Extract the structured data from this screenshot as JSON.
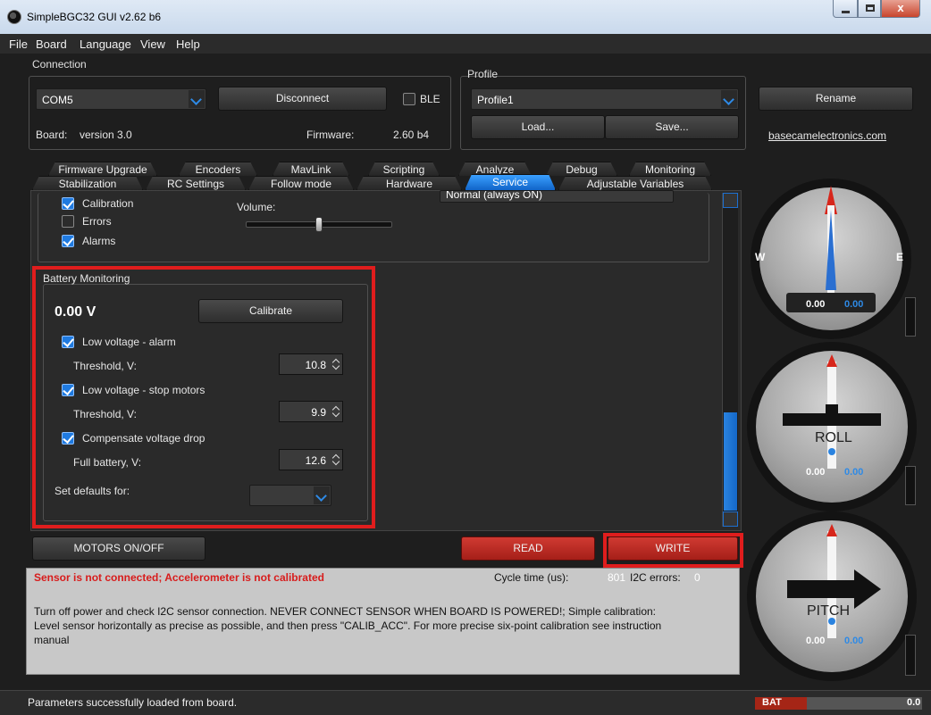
{
  "window": {
    "title": "SimpleBGC32 GUI v2.62 b6",
    "close_glyph": "x"
  },
  "menu": [
    "File",
    "Board",
    "Language",
    "View",
    "Help"
  ],
  "connection": {
    "label": "Connection",
    "port": "COM5",
    "disconnect_label": "Disconnect",
    "ble_label": "BLE",
    "board_label": "Board:",
    "board_value": "version 3.0",
    "firmware_label": "Firmware:",
    "firmware_value": "2.60 b4"
  },
  "profile": {
    "label": "Profile",
    "selected": "Profile1",
    "rename_label": "Rename",
    "load_label": "Load...",
    "save_label": "Save...",
    "website": "basecamelectronics.com"
  },
  "tabs_back": [
    "Firmware Upgrade",
    "Encoders",
    "MavLink",
    "Scripting",
    "Analyze",
    "Debug",
    "Monitoring"
  ],
  "tabs_front": [
    "Stabilization",
    "RC Settings",
    "Follow mode",
    "Hardware",
    "Service",
    "Adjustable Variables"
  ],
  "active_tab": "Service",
  "service": {
    "cut_dropdown": "Normal (always ON)",
    "volume_label": "Volume:",
    "checks_top": [
      {
        "label": "Calibration",
        "checked": true
      },
      {
        "label": "Errors",
        "checked": false
      },
      {
        "label": "Alarms",
        "checked": true
      }
    ],
    "battery": {
      "title": "Battery Monitoring",
      "voltage": "0.00 V",
      "calibrate_label": "Calibrate",
      "low_alarm": {
        "label": "Low voltage - alarm",
        "checked": true,
        "threshold_label": "Threshold, V:",
        "value": "10.8"
      },
      "low_stop": {
        "label": "Low voltage - stop motors",
        "checked": true,
        "threshold_label": "Threshold, V:",
        "value": "9.9"
      },
      "compensate": {
        "label": "Compensate voltage drop",
        "checked": true,
        "full_label": "Full battery, V:",
        "value": "12.6"
      },
      "defaults_label": "Set defaults for:"
    }
  },
  "actions": {
    "motors_label": "MOTORS ON/OFF",
    "read_label": "READ",
    "write_label": "WRITE"
  },
  "status_panel": {
    "error": "Sensor is not connected; Accelerometer is not calibrated",
    "cycle_label": "Cycle time (us):",
    "cycle_value": "801",
    "i2c_label": "I2C errors:",
    "i2c_value": "0",
    "message": "Turn off power and check I2C sensor connection. NEVER CONNECT SENSOR WHEN BOARD IS POWERED!; Simple calibration: Level sensor horizontally as precise as possible, and then press \"CALIB_ACC\". For more precise six-point calibration see instruction manual"
  },
  "statusbar": {
    "message": "Parameters successfully loaded from board.",
    "bat_label": "BAT",
    "bat_value": "0.0"
  },
  "gauges": {
    "yaw": {
      "west": "W",
      "east": "E",
      "value_white": "0.00",
      "value_blue": "0.00"
    },
    "roll": {
      "label": "ROLL",
      "value_white": "0.00",
      "value_blue": "0.00"
    },
    "pitch": {
      "label": "PITCH",
      "value_white": "0.00",
      "value_blue": "0.00"
    }
  },
  "colors": {
    "accent": "#1f7ae0",
    "alert": "#e01d1d",
    "error_text": "#d81c1c",
    "battery": "#a52516"
  }
}
